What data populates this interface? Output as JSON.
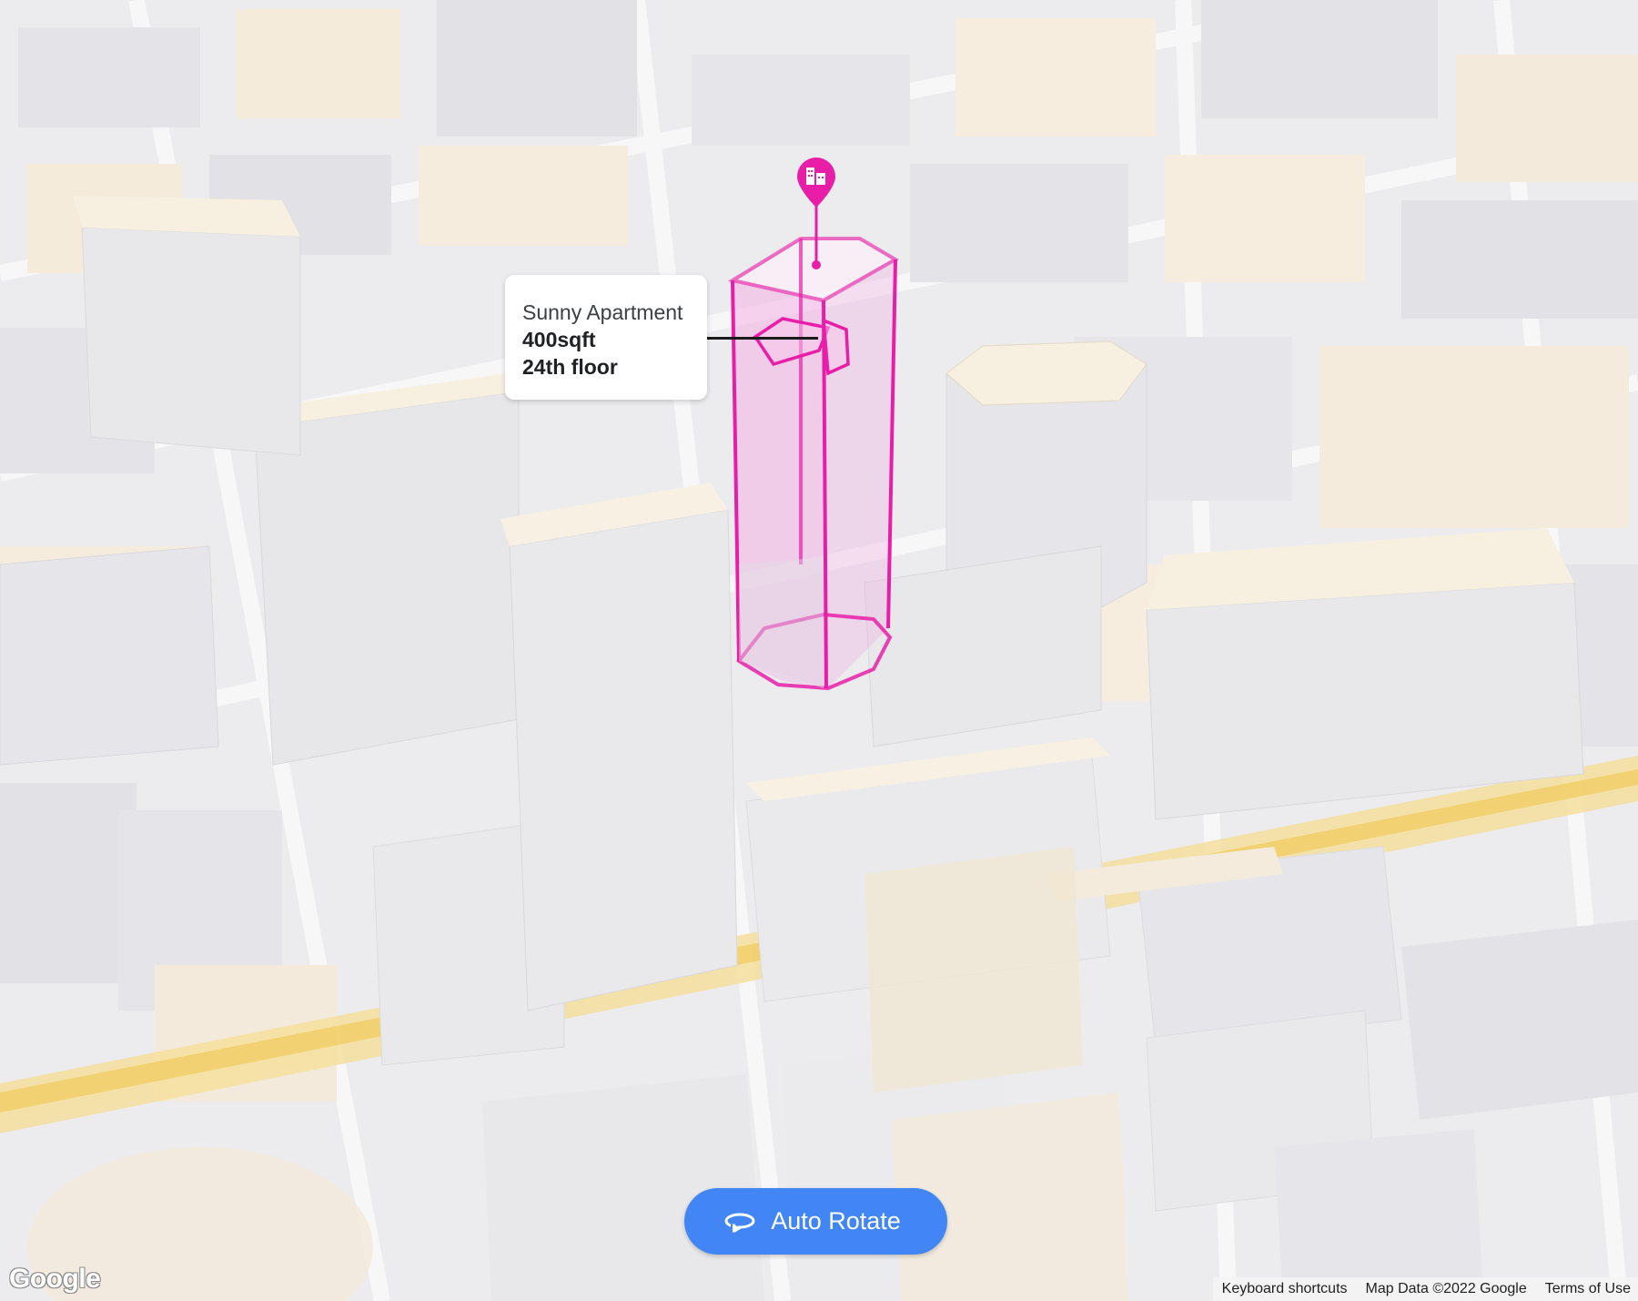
{
  "info_card": {
    "title": "Sunny Apartment",
    "size": "400sqft",
    "floor": "24th floor"
  },
  "marker": {
    "icon": "building-icon",
    "color": "#e91ea8"
  },
  "controls": {
    "auto_rotate_label": "Auto Rotate",
    "auto_rotate_icon": "rotate-icon",
    "accent": "#4285f4"
  },
  "branding": {
    "logo": "Google"
  },
  "footer": {
    "keyboard_shortcuts": "Keyboard shortcuts",
    "map_data": "Map Data ©2022 Google",
    "terms": "Terms of Use"
  },
  "colors": {
    "building_highlight": "#e91ea8",
    "building_top": "#fdf3e1",
    "road_highlight": "#f6d98a"
  }
}
